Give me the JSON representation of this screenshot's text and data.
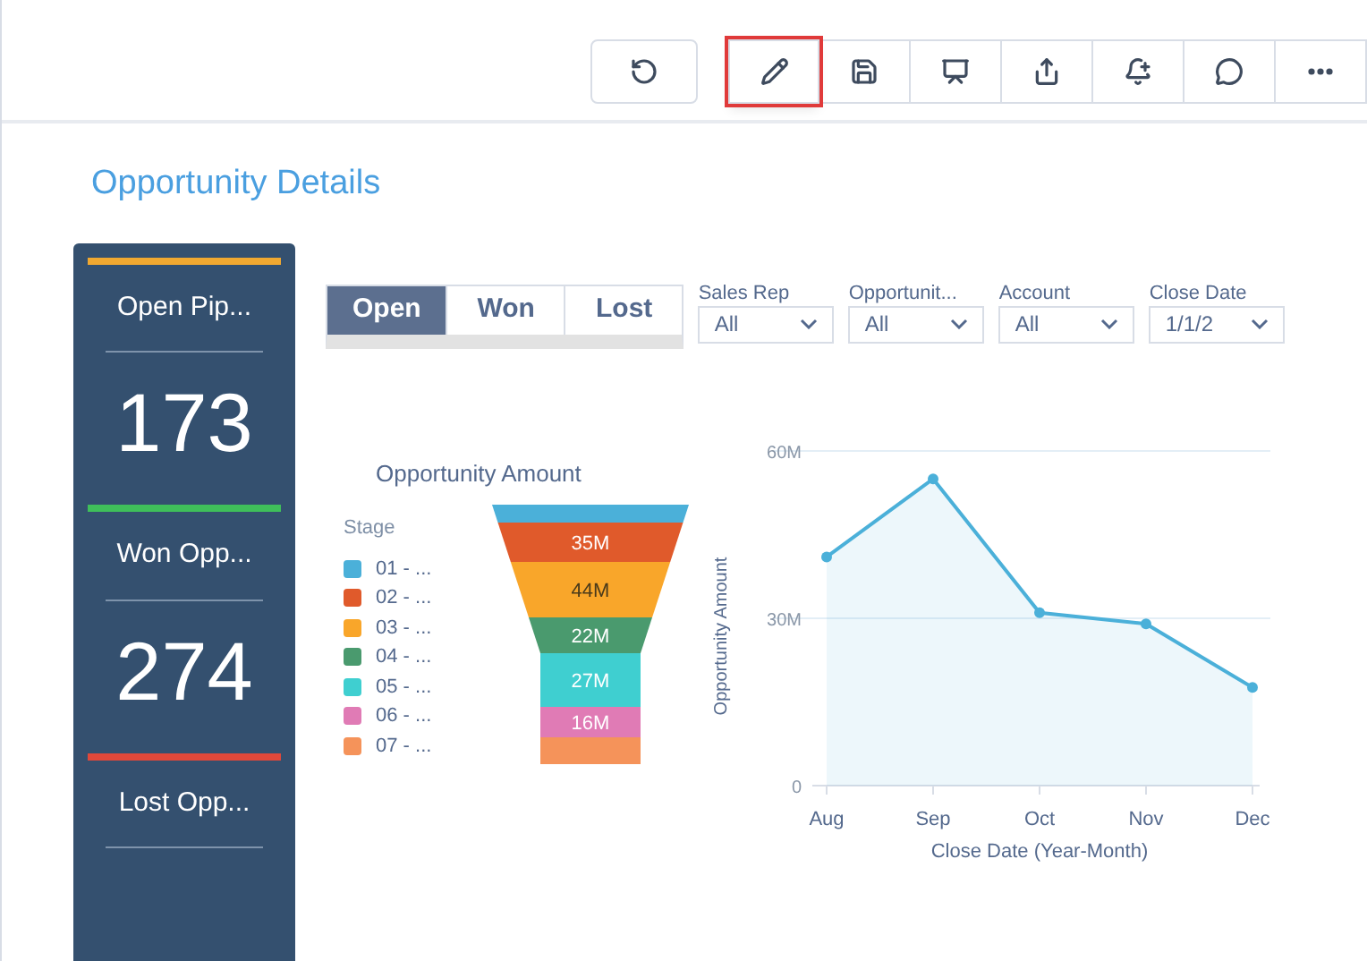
{
  "toolbar": {
    "buttons": [
      {
        "kind": "undo",
        "highlighted": false
      },
      {
        "kind": "edit",
        "highlighted": true
      },
      {
        "kind": "save",
        "highlighted": false
      },
      {
        "kind": "present",
        "highlighted": false
      },
      {
        "kind": "share",
        "highlighted": false
      },
      {
        "kind": "notify",
        "highlighted": false
      },
      {
        "kind": "comment",
        "highlighted": false
      },
      {
        "kind": "more",
        "highlighted": false
      }
    ]
  },
  "title": "Opportunity Details",
  "kpis": [
    {
      "label": "Open Pip...",
      "value": "173",
      "color": "#f0a830"
    },
    {
      "label": "Won Opp...",
      "value": "274",
      "color": "#3fbf5a"
    },
    {
      "label": "Lost Opp...",
      "color": "#e0483a"
    }
  ],
  "tabs": [
    {
      "label": "Open",
      "selected": true
    },
    {
      "label": "Won",
      "selected": false
    },
    {
      "label": "Lost",
      "selected": false
    }
  ],
  "filters": [
    {
      "label": "Sales Rep",
      "value": "All"
    },
    {
      "label": "Opportunit...",
      "value": "All"
    },
    {
      "label": "Account",
      "value": "All"
    },
    {
      "label": "Close Date",
      "value": "1/1/2"
    }
  ],
  "funnel": {
    "title": "Opportunity Amount",
    "legend_title": "Stage",
    "stages": [
      {
        "legend": "01 - ...",
        "color": "#4bb0d9"
      },
      {
        "legend": "02 - ...",
        "color": "#e05a2b",
        "value_label": "35M"
      },
      {
        "legend": "03 - ...",
        "color": "#f9a62a",
        "value_label": "44M"
      },
      {
        "legend": "04 - ...",
        "color": "#4a9a6e",
        "value_label": "22M"
      },
      {
        "legend": "05 - ...",
        "color": "#3fcfd0",
        "value_label": "27M"
      },
      {
        "legend": "06 - ...",
        "color": "#e07bb5",
        "value_label": "16M"
      },
      {
        "legend": "07 - ...",
        "color": "#f5935a"
      }
    ]
  },
  "line_chart": {
    "chart_data": {
      "type": "area",
      "xlabel": "Close Date (Year-Month)",
      "ylabel": "Opportunity Amount",
      "categories": [
        "Aug",
        "Sep",
        "Oct",
        "Nov",
        "Dec"
      ],
      "series": [
        {
          "color": "#4bb0d9",
          "values": [
            41,
            55,
            31,
            29,
            17.6
          ]
        }
      ],
      "ylim": [
        0,
        60
      ],
      "yticks": [
        {
          "value": 0,
          "label": "0"
        },
        {
          "value": 30,
          "label": "30M"
        },
        {
          "value": 60,
          "label": "60M"
        }
      ]
    }
  }
}
